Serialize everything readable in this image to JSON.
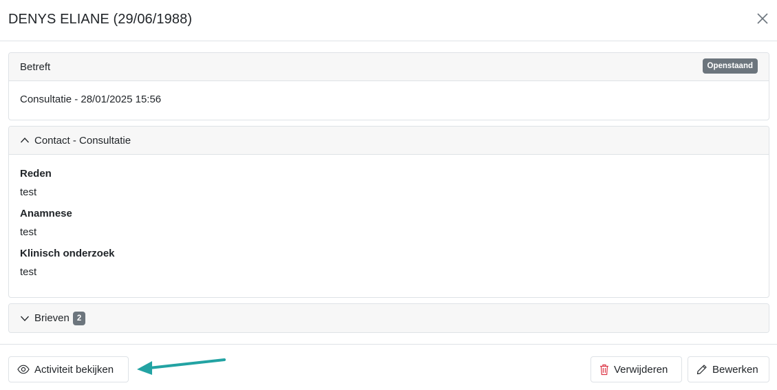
{
  "modal": {
    "title": "DENYS ELIANE (29/06/1988)"
  },
  "betreft": {
    "header": "Betreft",
    "status_badge": "Openstaand",
    "body": "Consultatie - 28/01/2025 15:56"
  },
  "contact": {
    "header": "Contact - Consultatie",
    "expanded": true,
    "fields": [
      {
        "label": "Reden",
        "value": "test"
      },
      {
        "label": "Anamnese",
        "value": "test"
      },
      {
        "label": "Klinisch onderzoek",
        "value": "test"
      }
    ]
  },
  "brieven": {
    "header": "Brieven",
    "count": "2",
    "expanded": false
  },
  "footer": {
    "view_activity_label": "Activiteit bekijken",
    "delete_label": "Verwijderen",
    "edit_label": "Bewerken"
  },
  "icons": {
    "close": "close-icon",
    "chevron_up": "chevron-up-icon",
    "chevron_down": "chevron-down-icon",
    "eye": "eye-icon",
    "trash": "trash-icon",
    "pencil": "pencil-icon",
    "arrow": "arrow-annotation"
  },
  "colors": {
    "badge": "#6c757d",
    "delete_icon": "#dc3545",
    "arrow": "#23a3a3"
  }
}
